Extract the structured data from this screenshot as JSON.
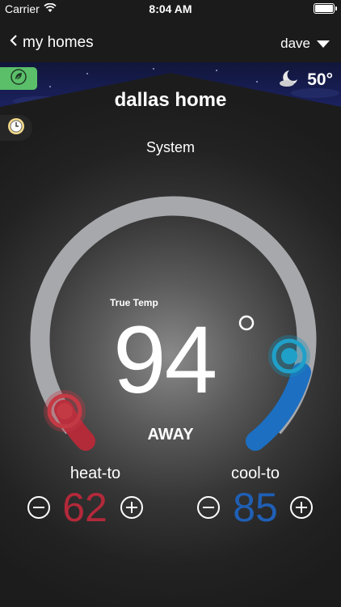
{
  "status_bar": {
    "carrier": "Carrier",
    "time": "8:04 AM"
  },
  "nav": {
    "back_label": "my homes",
    "user_label": "dave"
  },
  "weather": {
    "temperature": "50°",
    "icon": "moon-cloud-icon"
  },
  "home": {
    "name": "dallas home",
    "system_label": "System"
  },
  "thermostat": {
    "true_temp_label": "True Temp",
    "current_temp": "94",
    "mode": "AWAY"
  },
  "setpoints": {
    "heat": {
      "label": "heat-to",
      "value": "62"
    },
    "cool": {
      "label": "cool-to",
      "value": "85"
    }
  },
  "colors": {
    "heat": "#c32d3c",
    "cool": "#1f74c7",
    "leaf_badge": "#5bbf6a",
    "sky": "#1b2260"
  }
}
